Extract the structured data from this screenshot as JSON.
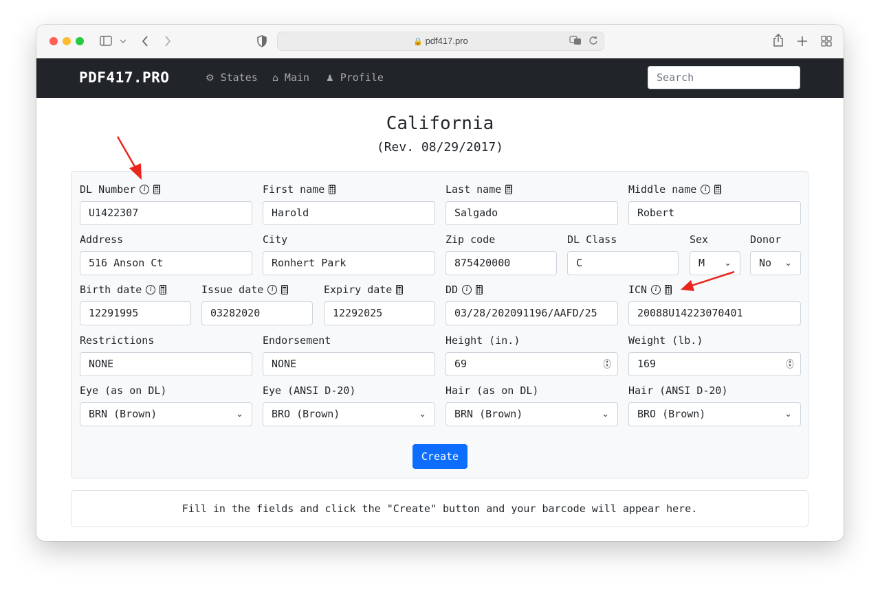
{
  "browser": {
    "url": "pdf417.pro"
  },
  "navbar": {
    "brand": "PDF417.PRO",
    "links": [
      {
        "label": "States",
        "icon": "gear-icon"
      },
      {
        "label": "Main",
        "icon": "home-icon"
      },
      {
        "label": "Profile",
        "icon": "person-icon"
      }
    ],
    "search_placeholder": "Search"
  },
  "page": {
    "title": "California",
    "subtitle": "(Rev. 08/29/2017)"
  },
  "form": {
    "dl_number": {
      "label": "DL Number",
      "value": "U1422307"
    },
    "first_name": {
      "label": "First name",
      "value": "Harold"
    },
    "last_name": {
      "label": "Last name",
      "value": "Salgado"
    },
    "middle_name": {
      "label": "Middle name",
      "value": "Robert"
    },
    "address": {
      "label": "Address",
      "value": "516 Anson Ct"
    },
    "city": {
      "label": "City",
      "value": "Ronhert Park"
    },
    "zip": {
      "label": "Zip code",
      "value": "875420000"
    },
    "dl_class": {
      "label": "DL Class",
      "value": "C"
    },
    "sex": {
      "label": "Sex",
      "value": "M"
    },
    "donor": {
      "label": "Donor",
      "value": "No"
    },
    "birth_date": {
      "label": "Birth date",
      "value": "12291995"
    },
    "issue_date": {
      "label": "Issue date",
      "value": "03282020"
    },
    "expiry_date": {
      "label": "Expiry date",
      "value": "12292025"
    },
    "dd": {
      "label": "DD",
      "value": "03/28/202091196/AAFD/25"
    },
    "icn": {
      "label": "ICN",
      "value": "20088U14223070401"
    },
    "restrictions": {
      "label": "Restrictions",
      "value": "NONE"
    },
    "endorsement": {
      "label": "Endorsement",
      "value": "NONE"
    },
    "height": {
      "label": "Height (in.)",
      "value": "69"
    },
    "weight": {
      "label": "Weight (lb.)",
      "value": "169"
    },
    "eye_dl": {
      "label": "Eye (as on DL)",
      "value": "BRN (Brown)"
    },
    "eye_ansi": {
      "label": "Eye (ANSI D-20)",
      "value": "BRO (Brown)"
    },
    "hair_dl": {
      "label": "Hair (as on DL)",
      "value": "BRN (Brown)"
    },
    "hair_ansi": {
      "label": "Hair (ANSI D-20)",
      "value": "BRO (Brown)"
    },
    "create_label": "Create"
  },
  "result_text": "Fill in the fields and click the \"Create\" button and your barcode will appear here.",
  "colors": {
    "navbar_bg": "#212529",
    "primary": "#0d6efd",
    "annotation_arrow": "#e8261c"
  }
}
